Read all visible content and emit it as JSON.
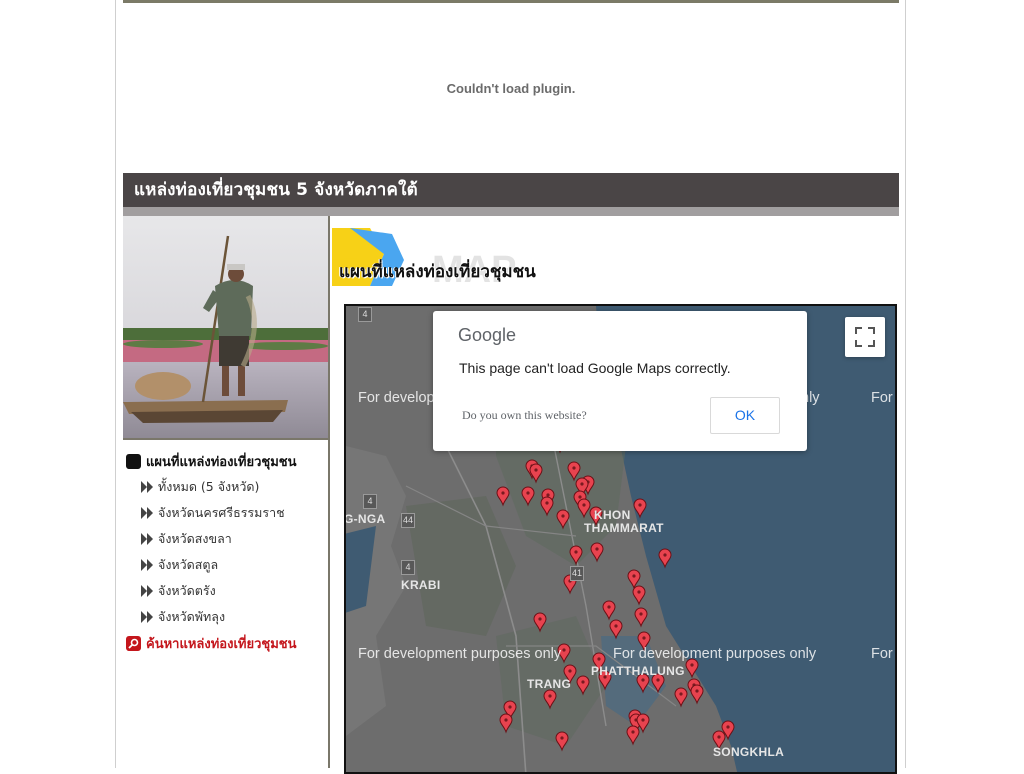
{
  "plugin": {
    "message": "Couldn't load plugin."
  },
  "header": {
    "title": "แหล่งท่องเที่ยวชุมชน 5 จังหวัดภาคใต้"
  },
  "sidebar": {
    "menu_title": "แผนที่แหล่งท่องเที่ยวชุมชน",
    "items": [
      {
        "label": "ทั้งหมด (5 จังหวัด)"
      },
      {
        "label": "จังหวัดนครศรีธรรมราช"
      },
      {
        "label": "จังหวัดสงขลา"
      },
      {
        "label": "จังหวัดสตูล"
      },
      {
        "label": "จังหวัดตรัง"
      },
      {
        "label": "จังหวัดพัทลุง"
      }
    ],
    "search_label": "ค้นหาแหล่งท่องเที่ยวชุมชน"
  },
  "map_section": {
    "logo_text": "แผนที่แหล่งท่องเที่ยวชุมชน",
    "logo_bg_text": "MAP"
  },
  "map": {
    "watermark": "For development purposes only",
    "watermark_short_right": "For",
    "watermark_left": "For develop",
    "watermark_right": "nly",
    "places": {
      "nakhon": "KHON",
      "thammarat": "THAMMARAT",
      "nga": "G-NGA",
      "krabi": "KRABI",
      "phatthalung": "PHATTHALUNG",
      "trang": "TRANG",
      "songkhla": "SONGKHLA"
    },
    "routes": [
      "4",
      "4",
      "44",
      "4",
      "41"
    ],
    "colors": {
      "sea": "#3f5b72",
      "land": "#6f6f6f",
      "marker": "#e8434f"
    }
  },
  "dialog": {
    "brand": "Google",
    "message": "This page can't load Google Maps correctly.",
    "link": "Do you own this website?",
    "ok_label": "OK"
  }
}
